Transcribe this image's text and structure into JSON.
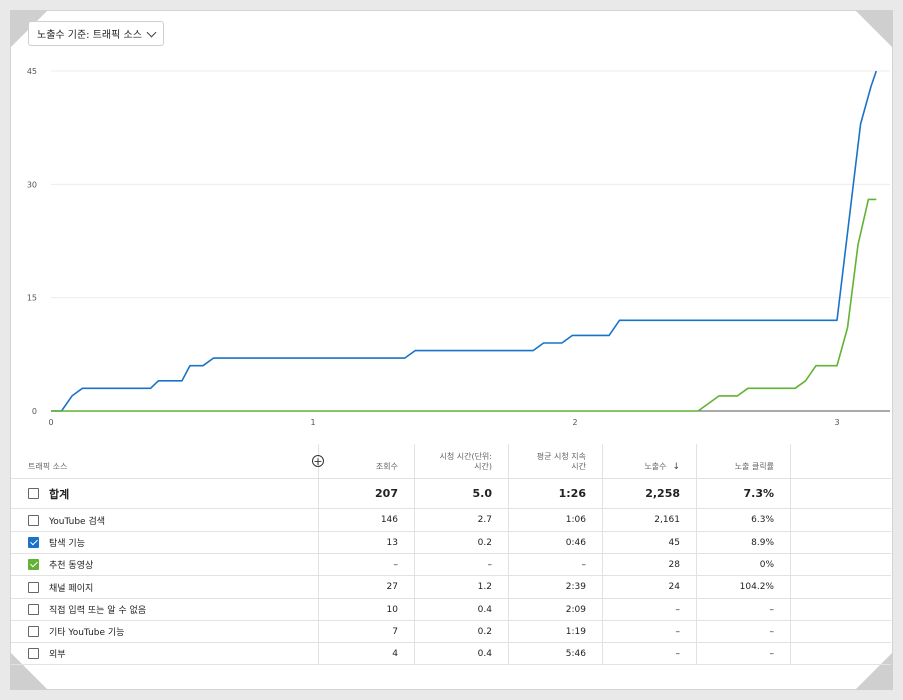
{
  "dropdown": {
    "label": "노출수 기준: 트래픽 소스"
  },
  "chart_data": {
    "type": "line",
    "xlim": [
      0,
      3.15
    ],
    "ylim": [
      0,
      45
    ],
    "x_ticks": [
      "0",
      "1",
      "2",
      "3"
    ],
    "y_ticks": [
      "0",
      "15",
      "30",
      "45"
    ],
    "grid": true,
    "series": [
      {
        "color": "#1a73c8",
        "points": [
          [
            0,
            0
          ],
          [
            0.04,
            0
          ],
          [
            0.08,
            2
          ],
          [
            0.12,
            3
          ],
          [
            0.38,
            3
          ],
          [
            0.41,
            4
          ],
          [
            0.5,
            4
          ],
          [
            0.53,
            6
          ],
          [
            0.58,
            6
          ],
          [
            0.62,
            7
          ],
          [
            1.35,
            7
          ],
          [
            1.39,
            8
          ],
          [
            1.84,
            8
          ],
          [
            1.88,
            9
          ],
          [
            1.95,
            9
          ],
          [
            1.99,
            10
          ],
          [
            2.13,
            10
          ],
          [
            2.17,
            12
          ],
          [
            3.0,
            12
          ],
          [
            3.09,
            38
          ],
          [
            3.13,
            43
          ],
          [
            3.15,
            45
          ]
        ]
      },
      {
        "color": "#62b234",
        "points": [
          [
            0,
            0
          ],
          [
            2.47,
            0
          ],
          [
            2.55,
            2
          ],
          [
            2.62,
            2
          ],
          [
            2.66,
            3
          ],
          [
            2.84,
            3
          ],
          [
            2.88,
            4
          ],
          [
            2.92,
            6
          ],
          [
            3.0,
            6
          ],
          [
            3.04,
            11
          ],
          [
            3.08,
            22
          ],
          [
            3.12,
            28
          ],
          [
            3.15,
            28
          ]
        ]
      }
    ]
  },
  "table": {
    "headers": {
      "source": "트래픽 소스",
      "views": "조회수",
      "watch_time": "시청 시간(단위:\n시간)",
      "avg_duration": "평균 시청 지속\n시간",
      "impressions": "노출수",
      "ctr": "노출 클릭률"
    },
    "sort_icon": "arrow-down-icon",
    "add_icon": "plus-circle-icon",
    "total": {
      "label": "합계",
      "views": "207",
      "watch_time": "5.0",
      "avg_duration": "1:26",
      "impressions": "2,258",
      "ctr": "7.3%"
    },
    "rows": [
      {
        "label": "YouTube 검색",
        "checked": "none",
        "views": "146",
        "watch_time": "2.7",
        "avg_duration": "1:06",
        "impressions": "2,161",
        "ctr": "6.3%"
      },
      {
        "label": "탐색 기능",
        "checked": "blue",
        "views": "13",
        "watch_time": "0.2",
        "avg_duration": "0:46",
        "impressions": "45",
        "ctr": "8.9%"
      },
      {
        "label": "추천 동영상",
        "checked": "green",
        "views": "–",
        "watch_time": "–",
        "avg_duration": "–",
        "impressions": "28",
        "ctr": "0%"
      },
      {
        "label": "채널 페이지",
        "checked": "none",
        "views": "27",
        "watch_time": "1.2",
        "avg_duration": "2:39",
        "impressions": "24",
        "ctr": "104.2%"
      },
      {
        "label": "직접 입력 또는 알 수 없음",
        "checked": "none",
        "views": "10",
        "watch_time": "0.4",
        "avg_duration": "2:09",
        "impressions": "–",
        "ctr": "–"
      },
      {
        "label": "기타 YouTube 기능",
        "checked": "none",
        "views": "7",
        "watch_time": "0.2",
        "avg_duration": "1:19",
        "impressions": "–",
        "ctr": "–"
      },
      {
        "label": "외부",
        "checked": "none",
        "views": "4",
        "watch_time": "0.4",
        "avg_duration": "5:46",
        "impressions": "–",
        "ctr": "–"
      }
    ]
  }
}
